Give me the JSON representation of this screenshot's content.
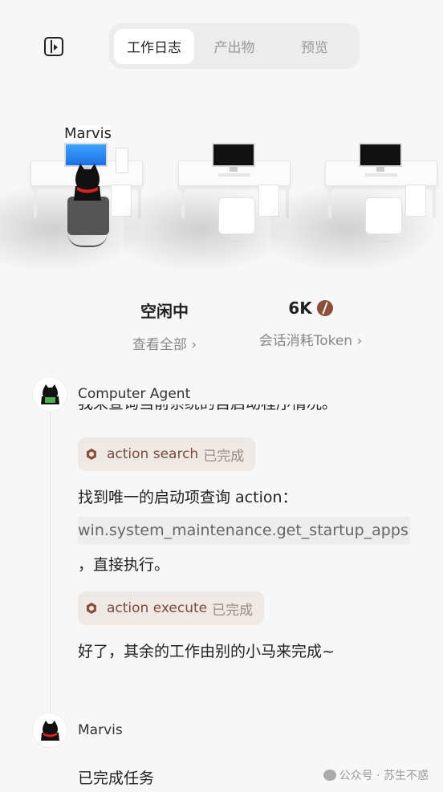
{
  "header": {
    "toggle_icon": "sidebar-toggle-icon",
    "tabs": [
      "工作日志",
      "产出物",
      "预览"
    ],
    "active_tab": 0
  },
  "office": {
    "agent_name": "Marvis"
  },
  "stats": {
    "status_value": "空闲中",
    "status_link": "查看全部",
    "tokens_value": "6K",
    "tokens_icon": "coffee-bean-icon",
    "tokens_link": "会话消耗Token"
  },
  "log": {
    "entries": [
      {
        "sender": "Computer Agent",
        "clipped_text": "我来查询当前系统的自启动程序情况。",
        "chip1": {
          "action": "action search",
          "status": "已完成"
        },
        "text1": "找到唯一的启动项查询 action：",
        "code": "win.system_maintenance.get_startup_apps",
        "text2": "，直接执行。",
        "chip2": {
          "action": "action execute",
          "status": "已完成"
        },
        "text3": "好了，其余的工作由别的小马来完成~"
      },
      {
        "sender": "Marvis",
        "text1": "已完成任务"
      }
    ]
  },
  "watermark": "公众号 · 苏生不惑",
  "colors": {
    "accent": "#8b4f3a",
    "chip_bg": "#efe9e6",
    "background": "#f7f7f7"
  }
}
